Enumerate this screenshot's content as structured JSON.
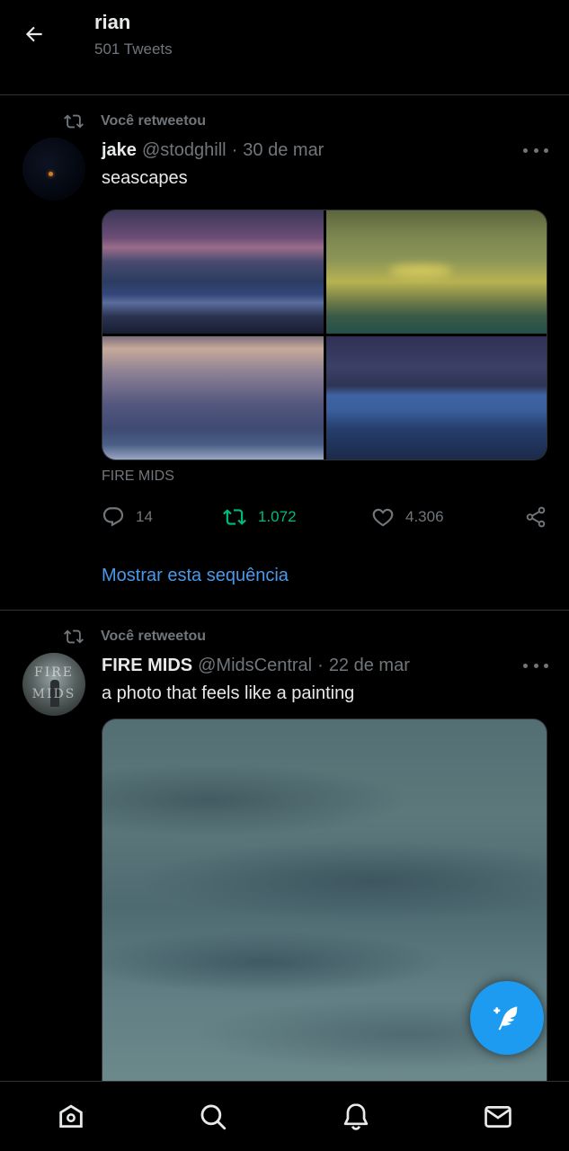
{
  "header": {
    "name": "rian",
    "tweet_count": "501 Tweets"
  },
  "tweets": [
    {
      "retweet_label": "Você retweetou",
      "author": "jake",
      "handle": "@stodghill",
      "separator": "·",
      "date": "30 de mar",
      "text": "seascapes",
      "source": "FIRE MIDS",
      "replies": "14",
      "retweets": "1.072",
      "likes": "4.306",
      "show_thread": "Mostrar esta sequência"
    },
    {
      "retweet_label": "Você retweetou",
      "author": "FIRE MIDS",
      "handle": "@MidsCentral",
      "separator": "·",
      "date": "22 de mar",
      "text": "a photo that feels like a painting",
      "avatar_text_top": "FIRE",
      "avatar_text_bottom": "MIDS"
    }
  ],
  "colors": {
    "accent": "#1d9bf0",
    "link": "#4a99e9",
    "retweet_active": "#00ba7c",
    "muted": "#71767b"
  },
  "icons": {
    "back": "arrow-left-icon",
    "retweet": "retweet-icon",
    "more": "more-horizontal-icon",
    "reply": "reply-icon",
    "like": "heart-icon",
    "share": "share-icon",
    "compose": "compose-feather-icon",
    "home": "home-icon",
    "search": "search-icon",
    "notifications": "bell-icon",
    "messages": "mail-icon"
  }
}
